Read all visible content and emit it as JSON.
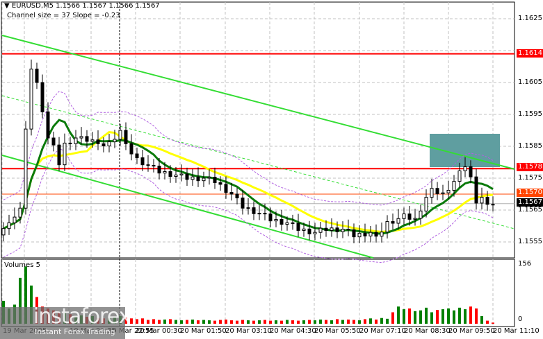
{
  "header": {
    "symbol_line": "EURUSD,M5  1.1566 1.1567 1.1566 1.1567",
    "channel_line": "Channel size = 37 Slope = -0.23"
  },
  "volume_panel": {
    "title": "Volumes 5",
    "max_label": "156",
    "zero_label": "0"
  },
  "price_labels": {
    "l1625": "1.1625",
    "l1605": "1.1605",
    "l1595": "1.1595",
    "l1585": "1.1585",
    "l1575": "1.1575",
    "l1565": "1.1565",
    "l1555": "1.1555"
  },
  "markers": {
    "resistance": "1.1614",
    "level": "1.1578",
    "bid": "1.1570",
    "last": "1.1567"
  },
  "time_labels": [
    "19 Mar 2025",
    "19 Mar 21:35",
    "19 Mar 22:55",
    "20 Mar 00:30",
    "20 Mar 01:50",
    "20 Mar 03:10",
    "20 Mar 04:30",
    "20 Mar 05:50",
    "20 Mar 07:10",
    "20 Mar 08:30",
    "20 Mar 09:50",
    "20 Mar 11:10"
  ],
  "watermark": {
    "brand": "instaforex",
    "tagline": "Instant Forex Trading"
  },
  "colors": {
    "up": "#ffffff",
    "down": "#000000",
    "ma_fast": "#0a7a0a",
    "ma_slow": "#ffff00",
    "channel": "#33dd33",
    "level": "#ff0000",
    "zone": "#5f9ea0",
    "vol_up": "#008000",
    "vol_down": "#ff0000"
  },
  "chart_data": {
    "type": "candlestick",
    "symbol": "EURUSD",
    "timeframe": "M5",
    "ylim": [
      1.1549,
      1.163
    ],
    "close_keypoints": [
      [
        0,
        1.156
      ],
      [
        2,
        1.1562
      ],
      [
        3,
        1.1566
      ],
      [
        4,
        1.159
      ],
      [
        5,
        1.161
      ],
      [
        6,
        1.1605
      ],
      [
        7,
        1.1595
      ],
      [
        8,
        1.1588
      ],
      [
        9,
        1.1585
      ],
      [
        10,
        1.158
      ],
      [
        11,
        1.1586
      ],
      [
        12,
        1.1585
      ],
      [
        13,
        1.1588
      ],
      [
        16,
        1.1587
      ],
      [
        17,
        1.1585
      ],
      [
        19,
        1.1586
      ],
      [
        21,
        1.159
      ],
      [
        22,
        1.1585
      ],
      [
        24,
        1.1581
      ],
      [
        26,
        1.1579
      ],
      [
        28,
        1.1577
      ],
      [
        31,
        1.1576
      ],
      [
        33,
        1.1575
      ],
      [
        36,
        1.1575
      ],
      [
        38,
        1.1574
      ],
      [
        41,
        1.157
      ],
      [
        43,
        1.1566
      ],
      [
        46,
        1.1564
      ],
      [
        48,
        1.1562
      ],
      [
        51,
        1.1561
      ],
      [
        53,
        1.1559
      ],
      [
        56,
        1.1558
      ],
      [
        58,
        1.1559
      ],
      [
        61,
        1.1559
      ],
      [
        63,
        1.1557
      ],
      [
        66,
        1.1558
      ],
      [
        67,
        1.1556
      ],
      [
        69,
        1.1561
      ],
      [
        72,
        1.1563
      ],
      [
        74,
        1.1562
      ],
      [
        76,
        1.1569
      ],
      [
        77,
        1.1571
      ],
      [
        79,
        1.157
      ],
      [
        81,
        1.1574
      ],
      [
        83,
        1.1579
      ],
      [
        84,
        1.1575
      ],
      [
        85,
        1.1568
      ],
      [
        86,
        1.1569
      ],
      [
        87,
        1.1566
      ],
      [
        88,
        1.1567
      ]
    ],
    "volumes": [
      60,
      40,
      50,
      120,
      150,
      100,
      70,
      45,
      40,
      35,
      30,
      28,
      25,
      20,
      22,
      18,
      20,
      15,
      14,
      15,
      18,
      20,
      16,
      14,
      12,
      14,
      10,
      12,
      10,
      11,
      12,
      10,
      9,
      10,
      11,
      9,
      10,
      9,
      8,
      10,
      11,
      9,
      8,
      10,
      9,
      8,
      9,
      10,
      8,
      9,
      8,
      10,
      9,
      8,
      9,
      10,
      9,
      11,
      10,
      9,
      12,
      10,
      11,
      10,
      9,
      12,
      14,
      11,
      15,
      13,
      30,
      45,
      38,
      40,
      33,
      35,
      42,
      30,
      36,
      38,
      40,
      35,
      42,
      38,
      45,
      40,
      20,
      8,
      3
    ],
    "horizontal_levels": [
      1.1614,
      1.1578,
      1.157,
      1.1567
    ],
    "vol_max": 156
  }
}
